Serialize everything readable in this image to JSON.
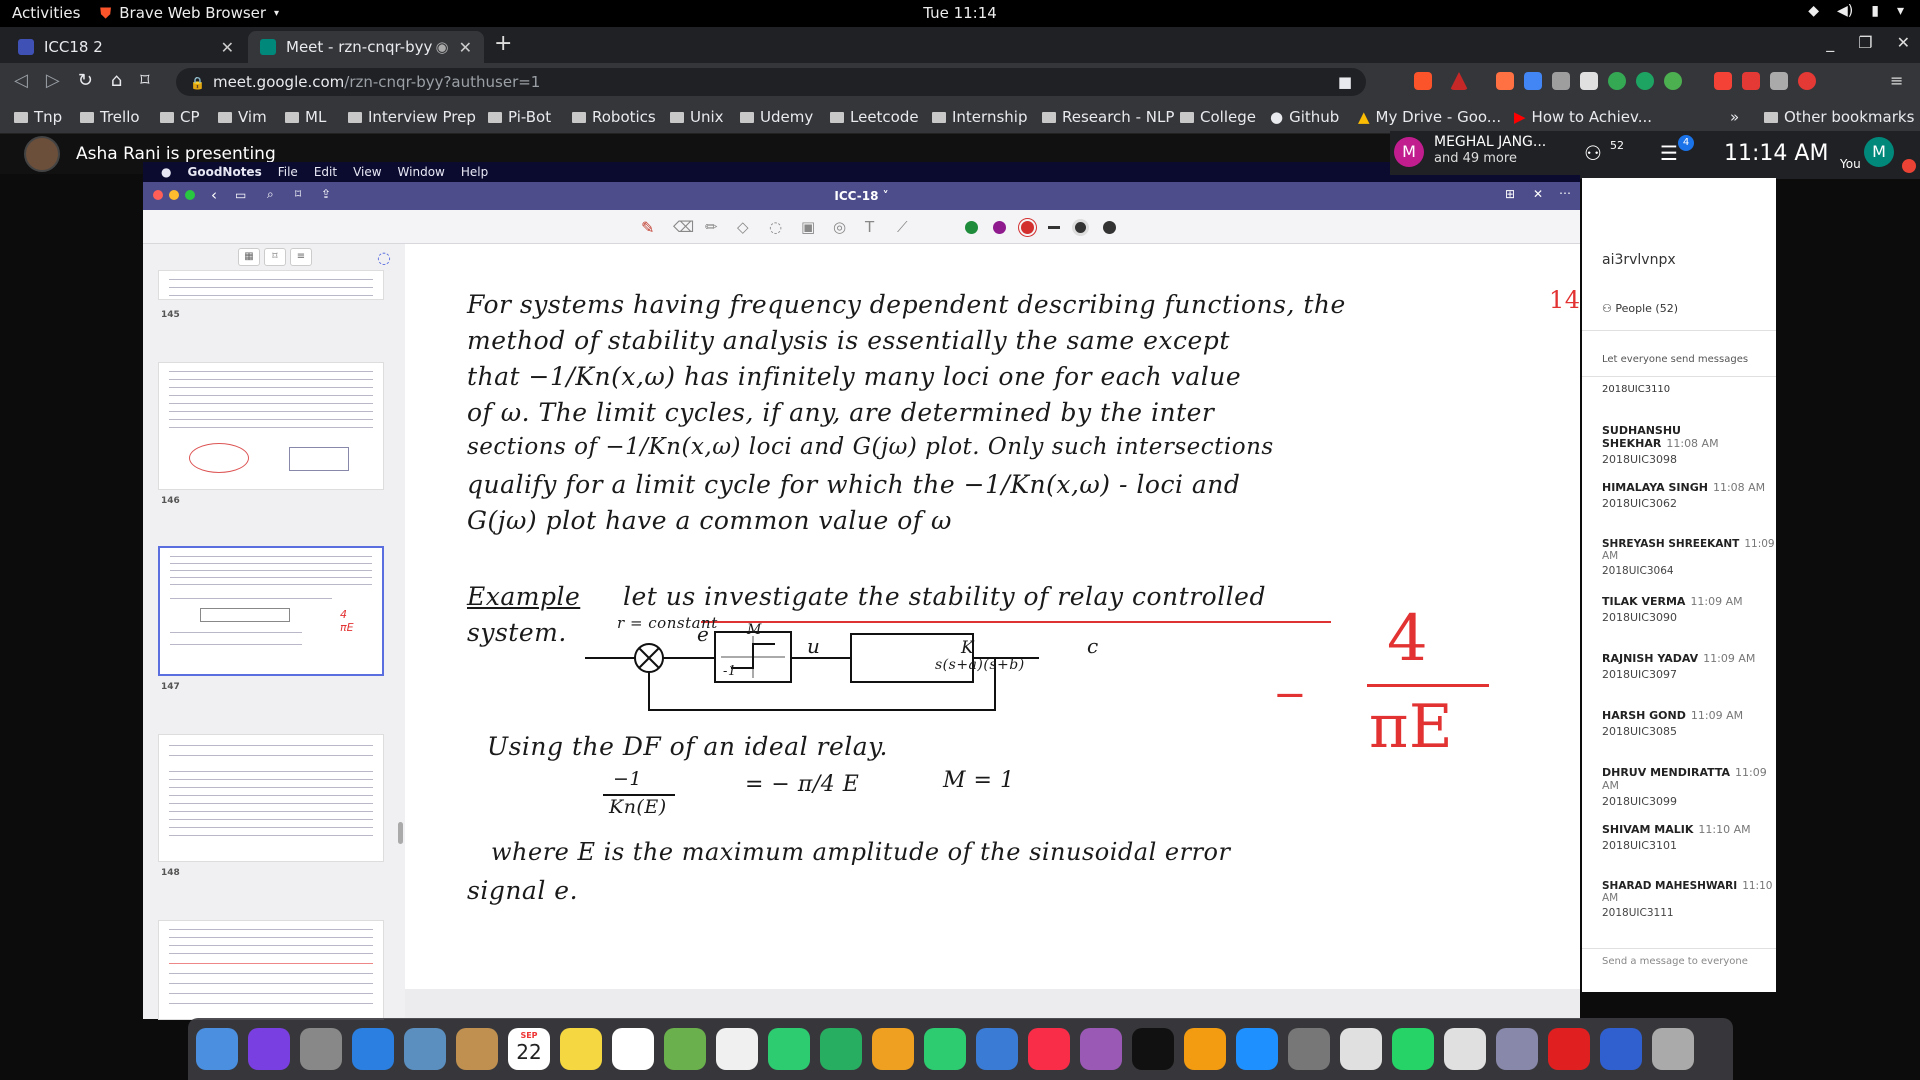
{
  "gnome": {
    "activities": "Activities",
    "app": "Brave Web Browser",
    "clock": "Tue 11:14"
  },
  "tabs": [
    {
      "label": "ICC18 2",
      "color": "#3f51b5"
    },
    {
      "label": "Meet - rzn-cnqr-byy",
      "color": "#00897b"
    }
  ],
  "address": {
    "host": "meet.google.com",
    "path": "/rzn-cnqr-byy?authuser=1"
  },
  "bookmarks": [
    "Tnp",
    "Trello",
    "CP",
    "Vim",
    "ML",
    "Interview Prep",
    "Pi-Bot",
    "Robotics",
    "Unix",
    "Udemy",
    "Leetcode",
    "Internship",
    "Research - NLP",
    "College",
    "Github",
    "My Drive - Goo...",
    "How to Achiev..."
  ],
  "bookmarks_more": "»",
  "other_bookmarks": "Other bookmarks",
  "meet": {
    "presenting": "Asha Rani is presenting",
    "presenter_name": "MEGHAL JANG...",
    "presenter_more": "and 49 more",
    "presenter_initial": "M",
    "people_count": "52",
    "chat_badge": "4",
    "time": "11:14 AM",
    "you": "You",
    "you_initial": "M"
  },
  "mac_menu": {
    "apple": "",
    "app": "GoodNotes",
    "items": [
      "File",
      "Edit",
      "View",
      "Window",
      "Help"
    ]
  },
  "goodnotes": {
    "title": "ICC-18 ˅",
    "page_number": "14"
  },
  "thumbs": [
    {
      "num": "145"
    },
    {
      "num": "146"
    },
    {
      "num": "147"
    },
    {
      "num": "148"
    }
  ],
  "note": {
    "lines": [
      "For systems having frequency dependent describing functions, the",
      "method of stability analysis is essentially the same except",
      "that −1/Kn(x,ω) has infinitely many loci one for each value",
      "of ω. The limit cycles, if any, are determined by the inter",
      "sections of −1/Kn(x,ω) loci and G(jω) plot. Only such intersections",
      "qualify for a limit cycle for which the −1/Kn(x,ω) - loci and",
      "G(jω) plot have a common value of ω"
    ],
    "example_label": "Example",
    "example_text": "let us investigate the stability of relay controlled",
    "system": "system.",
    "r_label": "r = constant",
    "e_label": "e",
    "u_label": "u",
    "c_label": "c",
    "relay_m": "M",
    "relay_neg": "-1",
    "plant_k": "K",
    "plant_den": "s(s+a)(s+b)",
    "df_text": "Using the DF of an ideal relay.",
    "eq_lhs_num": "−1",
    "eq_lhs_den": "Kn(E)",
    "eq_rhs": "= − π/4 E",
    "m_eq": "M = 1",
    "where_text": "where E is the maximum amplitude of the sinusoidal error",
    "signal_text": "signal e.",
    "red_num": "4",
    "red_den": "πE",
    "red_dash": "−"
  },
  "chat": {
    "meeting_code": "ai3rvlvnpx",
    "people": "People (52)",
    "setting": "Let everyone send messages",
    "first": "2018UIC3110",
    "messages": [
      {
        "name": "SUDHANSHU SHEKHAR",
        "time": "11:08 AM",
        "text": "2018UIC3098"
      },
      {
        "name": "HIMALAYA SINGH",
        "time": "11:08 AM",
        "text": "2018UIC3062"
      },
      {
        "name": "SHREYASH SHREEKANT",
        "time": "11:09 AM",
        "text": "2018UIC3064"
      },
      {
        "name": "TILAK VERMA",
        "time": "11:09 AM",
        "text": "2018UIC3090"
      },
      {
        "name": "RAJNISH YADAV",
        "time": "11:09 AM",
        "text": "2018UIC3097"
      },
      {
        "name": "HARSH GOND",
        "time": "11:09 AM",
        "text": "2018UIC3085"
      },
      {
        "name": "DHRUV MENDIRATTA",
        "time": "11:09 AM",
        "text": "2018UIC3099"
      },
      {
        "name": "SHIVAM MALIK",
        "time": "11:10 AM",
        "text": "2018UIC3101"
      },
      {
        "name": "SHARAD MAHESHWARI",
        "time": "11:10 AM",
        "text": "2018UIC3111"
      }
    ],
    "send_placeholder": "Send a message to everyone"
  },
  "dock": {
    "calendar_month": "SEP",
    "calendar_day": "22",
    "apps": [
      "finder",
      "siri",
      "launchpad",
      "safari",
      "mail",
      "contacts",
      "calendar",
      "notes",
      "reminders",
      "maps",
      "photos",
      "messages",
      "facetime",
      "pages",
      "numbers",
      "keynote",
      "music",
      "podcasts",
      "tv",
      "books",
      "app-store",
      "system-preferences",
      "chrome",
      "whatsapp",
      "goodnotes",
      "preview",
      "acrobat",
      "word",
      "trash"
    ],
    "colors": [
      "#4a8fe0",
      "#7a3fe0",
      "#888",
      "#2a7fe0",
      "#5a8fc0",
      "#c09050",
      "#fff",
      "#f5d742",
      "#fff",
      "#6ab04c",
      "#f0f0f0",
      "#2ecc71",
      "#27ae60",
      "#f0a020",
      "#2ecc71",
      "#3a7bd5",
      "#fa2d48",
      "#9b59b6",
      "#111",
      "#f39c12",
      "#1e90ff",
      "#777",
      "#e0e0e0",
      "#25d366",
      "#e0e0e0",
      "#8888aa",
      "#e02020",
      "#3060d0",
      "#aaa"
    ]
  }
}
